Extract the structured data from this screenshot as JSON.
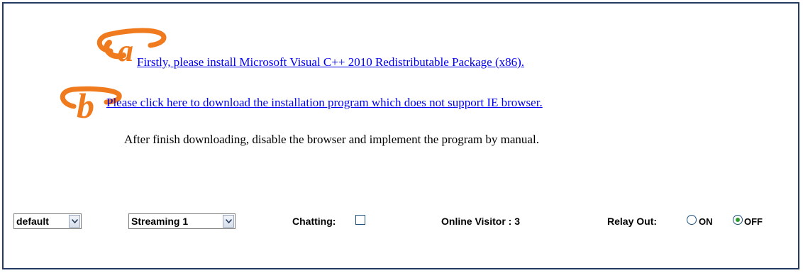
{
  "links": {
    "install_vc": "Firstly, please install Microsoft Visual C++ 2010 Redistributable Package (x86).",
    "download": "Please click here to download the installation program which does not support IE browser."
  },
  "note": "After finish downloading, disable the browser and implement the program by manual.",
  "markers": {
    "a": "a",
    "b": "b",
    "color": "#f07b1e"
  },
  "controls": {
    "quality_select": {
      "value": "default"
    },
    "stream_select": {
      "value": "Streaming 1"
    },
    "chatting": {
      "label": "Chatting:",
      "checked": false
    },
    "online_visitor": "Online Visitor : 3",
    "relay_out": {
      "label": "Relay Out:",
      "options": [
        "ON",
        "OFF"
      ],
      "selected": "OFF"
    }
  },
  "colors": {
    "link": "#0000ee",
    "border": "#233b63",
    "radio_selected": "#2d9a2d"
  }
}
